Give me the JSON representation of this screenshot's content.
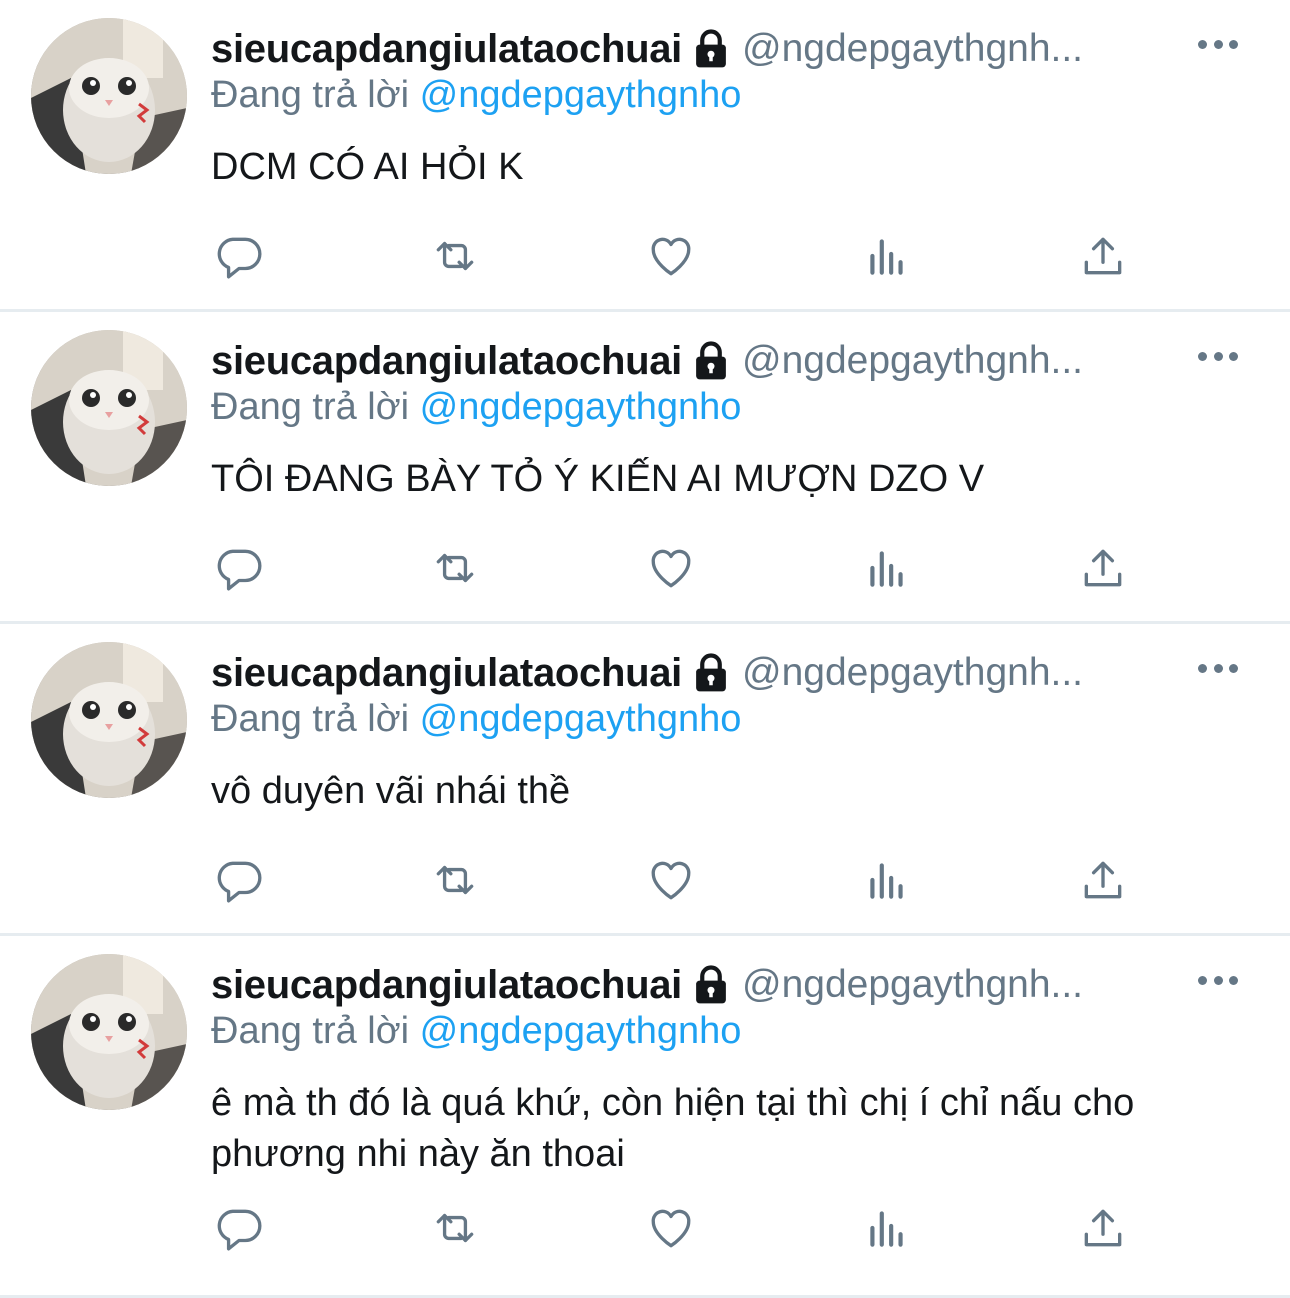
{
  "colors": {
    "accent": "#1da1f2",
    "secondary_text": "#657786",
    "primary_text": "#14171a",
    "divider": "#e6ecf0"
  },
  "icons": {
    "lock": "lock-icon",
    "more": "more-dots-icon",
    "reply": "reply-icon",
    "retweet": "retweet-icon",
    "like": "heart-icon",
    "views": "views-chart-icon",
    "share": "share-icon"
  },
  "tweets": [
    {
      "name": "sieucapdangiulataochuai",
      "handle": "@ngdepgaythgnh...",
      "reply_prefix": "Đang trả lời",
      "reply_mention": "@ngdepgaythgnho",
      "text": "DCM CÓ AI HỎI K"
    },
    {
      "name": "sieucapdangiulataochuai",
      "handle": "@ngdepgaythgnh...",
      "reply_prefix": "Đang trả lời",
      "reply_mention": "@ngdepgaythgnho",
      "text": "TÔI ĐANG BÀY TỎ Ý KIẾN AI MƯỢN DZO V"
    },
    {
      "name": "sieucapdangiulataochuai",
      "handle": "@ngdepgaythgnh...",
      "reply_prefix": "Đang trả lời",
      "reply_mention": "@ngdepgaythgnho",
      "text": "vô duyên vãi nhái thề"
    },
    {
      "name": "sieucapdangiulataochuai",
      "handle": "@ngdepgaythgnh...",
      "reply_prefix": "Đang trả lời",
      "reply_mention": "@ngdepgaythgnho",
      "text": "ê mà th đó là quá khứ, còn hiện tại thì chị í chỉ nấu cho phương nhi này ăn thoai"
    }
  ]
}
